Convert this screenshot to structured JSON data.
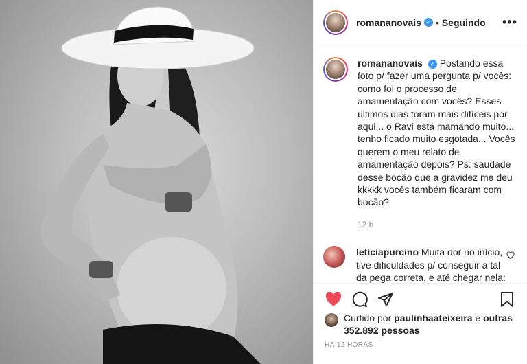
{
  "header": {
    "username": "romananovais",
    "separator": "•",
    "follow_status": "Seguindo",
    "more_label": "•••"
  },
  "caption": {
    "username": "romananovais",
    "text": "Postando essa foto p/ fazer uma pergunta p/ vocês: como foi o processo de amamentação com vocês? Esses últimos dias foram mais difíceis por aqui... o Ravi está mamando muito... tenho ficado muito esgotada... Vocês querem o meu relato de amamentação depois? Ps: saudade desse bocão que a gravidez me deu kkkkk vocês também ficaram com bocão?",
    "timestamp": "12 h"
  },
  "comment": {
    "username": "leticiapurcino",
    "text": "Muita dor no início, tive dificuldades p/ conseguir a tal da pega correta, e até chegar nela: muita dor, peito rachou e sangrava, chegava a amamentar"
  },
  "likes": {
    "prefix": "Curtido por",
    "user": "paulinhaateixeira",
    "middle": "e",
    "others": "outras 352.892 pessoas"
  },
  "post_age": "HÁ 12 HORAS",
  "icons": {
    "verified": "verified-badge",
    "like": "heart-icon",
    "comment": "comment-icon",
    "share": "share-icon",
    "save": "bookmark-icon",
    "comment_like": "heart-outline-icon"
  },
  "colors": {
    "like_red": "#ed4956",
    "verified_blue": "#3897f0",
    "muted": "#8e8e8e",
    "text": "#262626"
  }
}
